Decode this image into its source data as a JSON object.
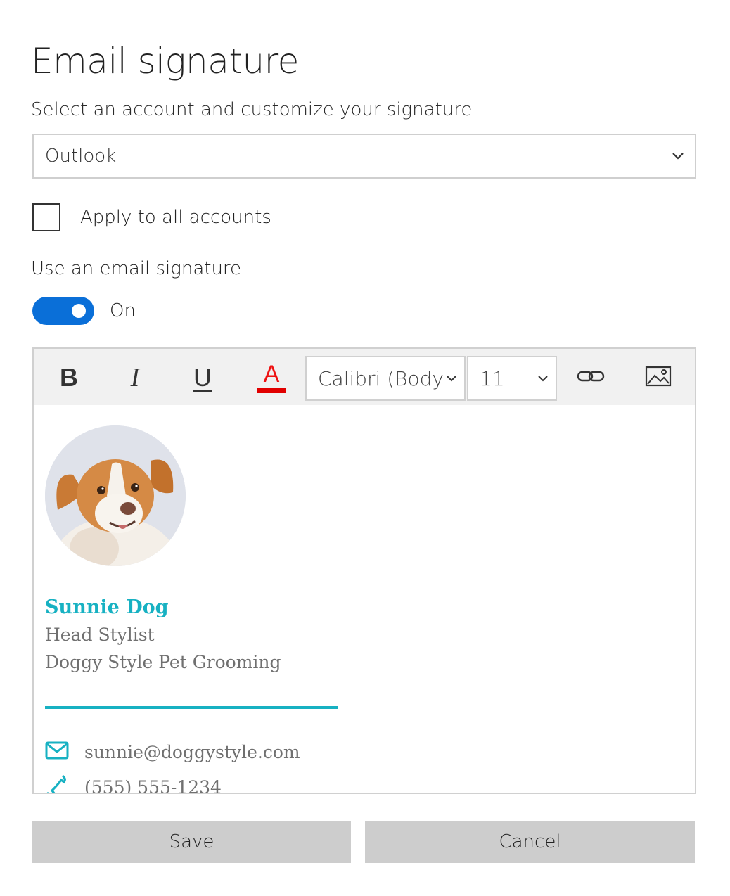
{
  "dialog": {
    "title": "Email signature",
    "subtitle": "Select an account and customize your signature"
  },
  "account_select": {
    "value": "Outlook",
    "icon": "chevron-down-icon"
  },
  "apply_all": {
    "label": "Apply to all accounts",
    "checked": false
  },
  "signature_toggle": {
    "label": "Use an email signature",
    "state_label": "On",
    "on": true,
    "color": "#0a6fd8"
  },
  "toolbar": {
    "bold_label": "B",
    "italic_label": "I",
    "underline_label": "U",
    "font_color_label": "A",
    "font_color": "#e10000",
    "font_family": "Calibri (Body",
    "font_size": "11",
    "link_icon": "link-icon",
    "image_icon": "image-icon"
  },
  "signature": {
    "photo": "dog-photo",
    "name": "Sunnie Dog",
    "job_title": "Head Stylist",
    "company": "Doggy Style Pet Grooming",
    "email": "sunnie@doggystyle.com",
    "phone": "(555) 555-1234",
    "accent_color": "#17b1c2",
    "text_color": "#707070"
  },
  "actions": {
    "save_label": "Save",
    "cancel_label": "Cancel"
  }
}
